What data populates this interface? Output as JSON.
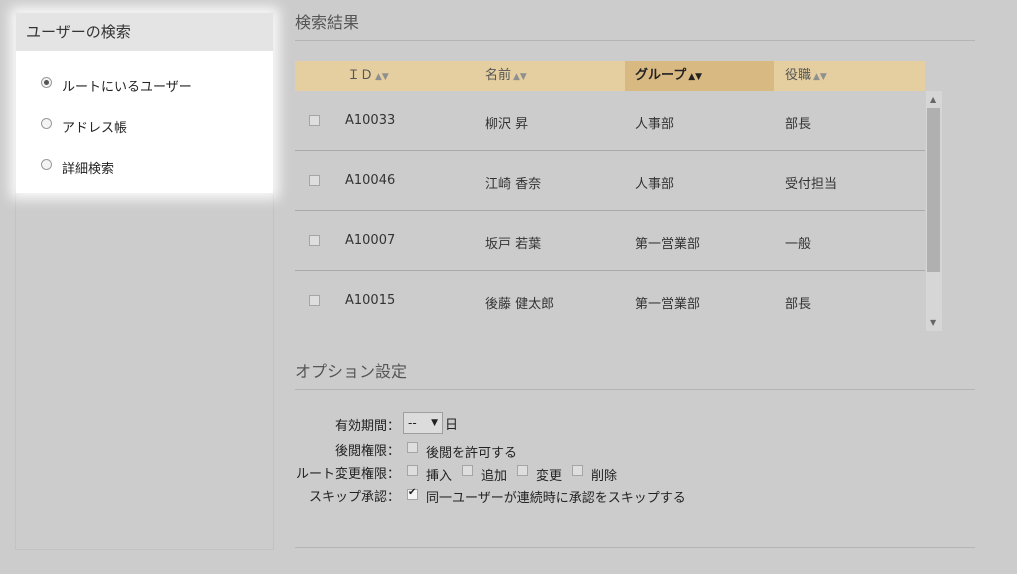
{
  "sidebar": {
    "title": "ユーザーの検索",
    "options": [
      {
        "label": "ルートにいるユーザー",
        "checked": true
      },
      {
        "label": "アドレス帳",
        "checked": false
      },
      {
        "label": "詳細検索",
        "checked": false
      }
    ]
  },
  "results": {
    "title": "検索結果",
    "columns": [
      {
        "label": "ＩＤ",
        "sort_icon": "sort-both-icon"
      },
      {
        "label": "名前",
        "sort_icon": "sort-both-icon"
      },
      {
        "label": "グループ",
        "sort_icon": "sort-active-icon",
        "active": true
      },
      {
        "label": "役職",
        "sort_icon": "sort-both-icon"
      }
    ],
    "rows": [
      {
        "id": "A10033",
        "name": "柳沢 昇",
        "group": "人事部",
        "role": "部長"
      },
      {
        "id": "A10046",
        "name": "江崎 香奈",
        "group": "人事部",
        "role": "受付担当"
      },
      {
        "id": "A10007",
        "name": "坂戸 若葉",
        "group": "第一営業部",
        "role": "一般"
      },
      {
        "id": "A10015",
        "name": "後藤 健太郎",
        "group": "第一営業部",
        "role": "部長"
      }
    ]
  },
  "options": {
    "title": "オプション設定",
    "validity": {
      "label": "有効期間：",
      "value": "--",
      "unit": "日"
    },
    "view_permission": {
      "label": "後閲権限：",
      "checkbox_label": "後閲を許可する",
      "checked": false
    },
    "route_permission": {
      "label": "ルート変更権限：",
      "items": [
        {
          "label": "挿入",
          "checked": false
        },
        {
          "label": "追加",
          "checked": false
        },
        {
          "label": "変更",
          "checked": false
        },
        {
          "label": "削除",
          "checked": false
        }
      ]
    },
    "skip_approval": {
      "label": "スキップ承認：",
      "checkbox_label": "同一ユーザーが連続時に承認をスキップする",
      "checked": true
    }
  },
  "colors": {
    "header_bg": "#e5cfa0",
    "header_active_bg": "#d9b982",
    "page_bg": "#cccccc"
  }
}
